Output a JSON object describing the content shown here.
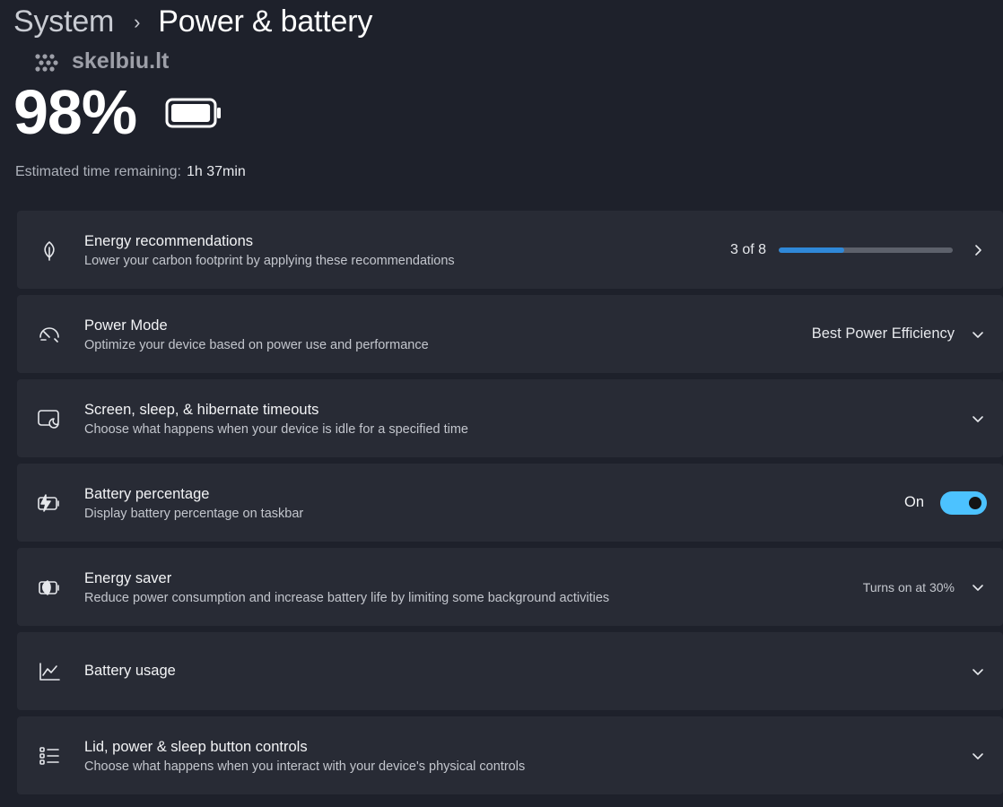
{
  "breadcrumb": {
    "parent": "System",
    "separator": "›",
    "current": "Power & battery"
  },
  "watermark": "skelbiu.lt",
  "battery": {
    "percent": "98%",
    "level": 0.98,
    "estimate_label": "Estimated time remaining:",
    "estimate_value": "1h 37min"
  },
  "colors": {
    "background": "#1e212b",
    "card": "#282b35",
    "accent": "#4cc2ff",
    "progress": "#2f88d8"
  },
  "settings": [
    {
      "title": "Energy recommendations",
      "description": "Lower your carbon footprint by applying these recommendations",
      "icon": "leaf-icon",
      "control": "progress",
      "progress_label": "3 of 8",
      "progress_value": 0.375
    },
    {
      "title": "Power Mode",
      "description": "Optimize your device based on power use and performance",
      "icon": "speedometer-icon",
      "control": "dropdown",
      "value": "Best Power Efficiency"
    },
    {
      "title": "Screen, sleep, & hibernate timeouts",
      "description": "Choose what happens when your device is idle for a specified time",
      "icon": "screen-sleep-icon",
      "control": "expand"
    },
    {
      "title": "Battery percentage",
      "description": "Display battery percentage on taskbar",
      "icon": "battery-charging-icon",
      "control": "toggle",
      "toggle_label": "On",
      "toggle_state": true
    },
    {
      "title": "Energy saver",
      "description": "Reduce power consumption and increase battery life by limiting some background activities",
      "icon": "energy-saver-icon",
      "control": "expand",
      "value": "Turns on at 30%"
    },
    {
      "title": "Battery usage",
      "icon": "chart-icon",
      "control": "expand"
    },
    {
      "title": "Lid, power & sleep button controls",
      "description": "Choose what happens when you interact with your device's physical controls",
      "icon": "list-icon",
      "control": "expand"
    }
  ]
}
